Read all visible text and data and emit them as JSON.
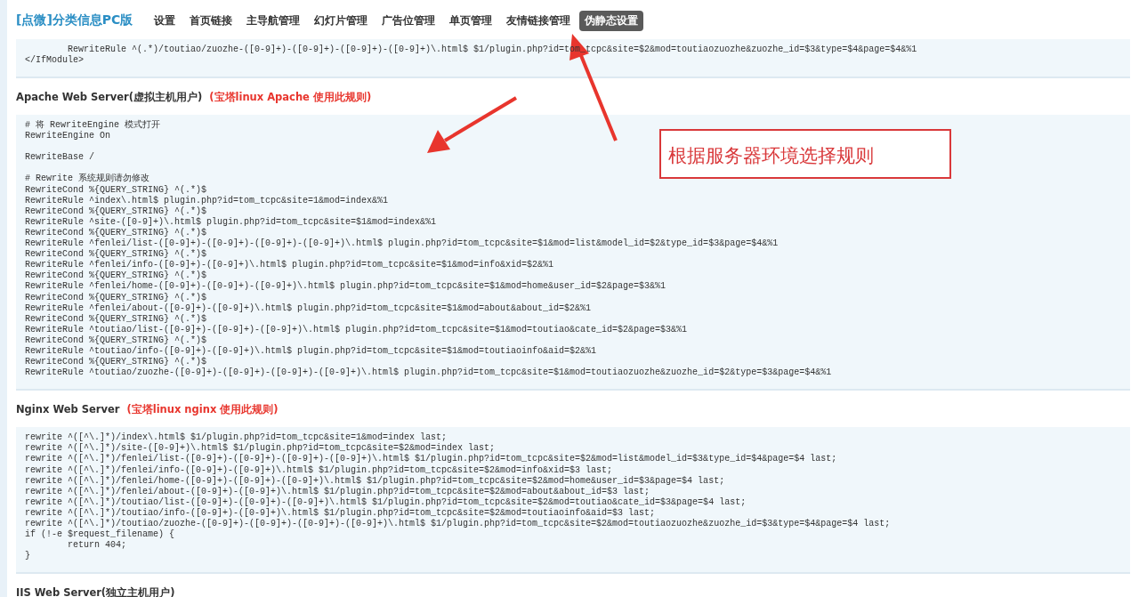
{
  "header": {
    "title": "[点微]分类信息PC版",
    "nav": [
      {
        "label": "设置",
        "selected": false
      },
      {
        "label": "首页链接",
        "selected": false
      },
      {
        "label": "主导航管理",
        "selected": false
      },
      {
        "label": "幻灯片管理",
        "selected": false
      },
      {
        "label": "广告位管理",
        "selected": false
      },
      {
        "label": "单页管理",
        "selected": false
      },
      {
        "label": "友情链接管理",
        "selected": false
      },
      {
        "label": "伪静态设置",
        "selected": true
      }
    ]
  },
  "sections": [
    {
      "code": [
        [
          "        RewriteRule ^(.*)/toutiao/zuozhe-([0-9]+)-([0-9]+)-([0-9]+)-([0-9]+)\\.html$ $1/plugin.php?id=tom_tcpc&site=$2&mod=toutiaozuozhe&zuozhe_id=$3&type=$4&page=$4&%1",
          "</IfModule>"
        ]
      ]
    },
    {
      "title": "Apache Web Server(虚拟主机用户)",
      "note": "(宝塔linux Apache 使用此规则)",
      "code": [
        [
          "# 将 RewriteEngine 模式打开",
          "RewriteEngine On"
        ],
        [
          "RewriteBase /"
        ],
        [
          "# Rewrite 系统规则请勿修改",
          "RewriteCond %{QUERY_STRING} ^(.*)$",
          "RewriteRule ^index\\.html$ plugin.php?id=tom_tcpc&site=1&mod=index&%1",
          "RewriteCond %{QUERY_STRING} ^(.*)$",
          "RewriteRule ^site-([0-9]+)\\.html$ plugin.php?id=tom_tcpc&site=$1&mod=index&%1",
          "RewriteCond %{QUERY_STRING} ^(.*)$",
          "RewriteRule ^fenlei/list-([0-9]+)-([0-9]+)-([0-9]+)-([0-9]+)\\.html$ plugin.php?id=tom_tcpc&site=$1&mod=list&model_id=$2&type_id=$3&page=$4&%1",
          "RewriteCond %{QUERY_STRING} ^(.*)$",
          "RewriteRule ^fenlei/info-([0-9]+)-([0-9]+)\\.html$ plugin.php?id=tom_tcpc&site=$1&mod=info&xid=$2&%1",
          "RewriteCond %{QUERY_STRING} ^(.*)$",
          "RewriteRule ^fenlei/home-([0-9]+)-([0-9]+)-([0-9]+)\\.html$ plugin.php?id=tom_tcpc&site=$1&mod=home&user_id=$2&page=$3&%1",
          "RewriteCond %{QUERY_STRING} ^(.*)$",
          "RewriteRule ^fenlei/about-([0-9]+)-([0-9]+)\\.html$ plugin.php?id=tom_tcpc&site=$1&mod=about&about_id=$2&%1",
          "RewriteCond %{QUERY_STRING} ^(.*)$",
          "RewriteRule ^toutiao/list-([0-9]+)-([0-9]+)-([0-9]+)\\.html$ plugin.php?id=tom_tcpc&site=$1&mod=toutiao&cate_id=$2&page=$3&%1",
          "RewriteCond %{QUERY_STRING} ^(.*)$",
          "RewriteRule ^toutiao/info-([0-9]+)-([0-9]+)\\.html$ plugin.php?id=tom_tcpc&site=$1&mod=toutiaoinfo&aid=$2&%1",
          "RewriteCond %{QUERY_STRING} ^(.*)$",
          "RewriteRule ^toutiao/zuozhe-([0-9]+)-([0-9]+)-([0-9]+)-([0-9]+)\\.html$ plugin.php?id=tom_tcpc&site=$1&mod=toutiaozuozhe&zuozhe_id=$2&type=$3&page=$4&%1"
        ]
      ]
    },
    {
      "title": "Nginx Web Server",
      "note": "(宝塔linux nginx 使用此规则)",
      "code": [
        [
          "rewrite ^([^\\.]*)/index\\.html$ $1/plugin.php?id=tom_tcpc&site=1&mod=index last;",
          "rewrite ^([^\\.]*)/site-([0-9]+)\\.html$ $1/plugin.php?id=tom_tcpc&site=$2&mod=index last;",
          "rewrite ^([^\\.]*)/fenlei/list-([0-9]+)-([0-9]+)-([0-9]+)-([0-9]+)\\.html$ $1/plugin.php?id=tom_tcpc&site=$2&mod=list&model_id=$3&type_id=$4&page=$4 last;",
          "rewrite ^([^\\.]*)/fenlei/info-([0-9]+)-([0-9]+)\\.html$ $1/plugin.php?id=tom_tcpc&site=$2&mod=info&xid=$3 last;",
          "rewrite ^([^\\.]*)/fenlei/home-([0-9]+)-([0-9]+)-([0-9]+)\\.html$ $1/plugin.php?id=tom_tcpc&site=$2&mod=home&user_id=$3&page=$4 last;",
          "rewrite ^([^\\.]*)/fenlei/about-([0-9]+)-([0-9]+)\\.html$ $1/plugin.php?id=tom_tcpc&site=$2&mod=about&about_id=$3 last;",
          "rewrite ^([^\\.]*)/toutiao/list-([0-9]+)-([0-9]+)-([0-9]+)\\.html$ $1/plugin.php?id=tom_tcpc&site=$2&mod=toutiao&cate_id=$3&page=$4 last;",
          "rewrite ^([^\\.]*)/toutiao/info-([0-9]+)-([0-9]+)\\.html$ $1/plugin.php?id=tom_tcpc&site=$2&mod=toutiaoinfo&aid=$3 last;",
          "rewrite ^([^\\.]*)/toutiao/zuozhe-([0-9]+)-([0-9]+)-([0-9]+)-([0-9]+)\\.html$ $1/plugin.php?id=tom_tcpc&site=$2&mod=toutiaozuozhe&zuozhe_id=$3&type=$4&page=$4 last;",
          "if (!-e $request_filename) {",
          "        return 404;",
          "}"
        ]
      ]
    },
    {
      "title": "IIS Web Server(独立主机用户)"
    }
  ],
  "callout": {
    "text": "根据服务器环境选择规则"
  }
}
